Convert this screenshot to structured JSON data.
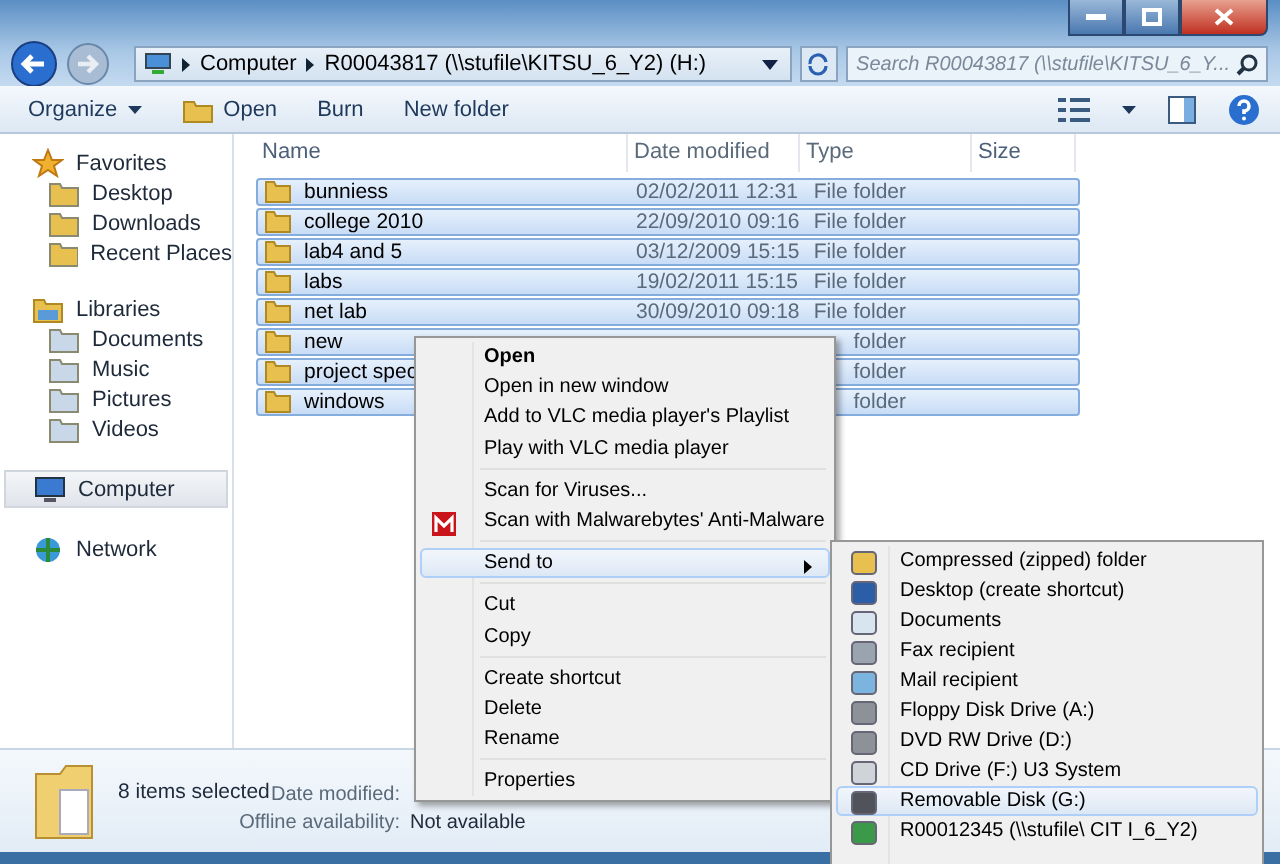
{
  "address": {
    "crumbs": [
      "Computer",
      "R00043817 (\\\\stufile\\KITSU_6_Y2) (H:)"
    ]
  },
  "search": {
    "placeholder": "Search R00043817 (\\\\stufile\\KITSU_6_Y..."
  },
  "toolbar": [
    {
      "label": "Organize",
      "kind": "menu"
    },
    {
      "label": "Open",
      "kind": "icon"
    },
    {
      "label": "Burn",
      "kind": "plain"
    },
    {
      "label": "New folder",
      "kind": "plain"
    }
  ],
  "sidebar": [
    {
      "label": "Favorites",
      "selected": false,
      "children": [
        {
          "label": "Desktop"
        },
        {
          "label": "Downloads"
        },
        {
          "label": "Recent Places"
        }
      ]
    },
    {
      "label": "Libraries",
      "selected": false,
      "children": [
        {
          "label": "Documents"
        },
        {
          "label": "Music"
        },
        {
          "label": "Pictures"
        },
        {
          "label": "Videos"
        }
      ]
    },
    {
      "label": "Computer",
      "selected": true
    },
    {
      "label": "Network",
      "selected": false
    }
  ],
  "table": {
    "columns": [
      "Name",
      "Date modified",
      "Type",
      "Size"
    ],
    "rows": [
      {
        "name": "bunniess",
        "date": "02/02/2011 12:31",
        "type": "File folder",
        "selected": true
      },
      {
        "name": "college 2010",
        "date": "22/09/2010 09:16",
        "type": "File folder",
        "selected": true
      },
      {
        "name": "lab4 and 5",
        "date": "03/12/2009 15:15",
        "type": "File folder",
        "selected": true
      },
      {
        "name": "labs",
        "date": "19/02/2011 15:15",
        "type": "File folder",
        "selected": true
      },
      {
        "name": "net lab",
        "date": "30/09/2010 09:18",
        "type": "File folder",
        "selected": true
      },
      {
        "name": "new",
        "type": "folder",
        "selected": true
      },
      {
        "name": "project spec",
        "type": "folder",
        "selected": true
      },
      {
        "name": "windows",
        "type": "folder",
        "selected": true
      }
    ]
  },
  "context_menu": [
    [
      {
        "label": "Open",
        "bold": true,
        "selected": false
      },
      {
        "label": "Open in new window",
        "bold": false,
        "selected": false
      },
      {
        "label": "Add to VLC media player's Playlist",
        "bold": false,
        "selected": false
      },
      {
        "label": "Play with VLC media player",
        "bold": false,
        "selected": false
      }
    ],
    [
      {
        "label": "Scan for Viruses...",
        "bold": false,
        "selected": false
      },
      {
        "label": "Scan with Malwarebytes' Anti-Malware",
        "bold": false,
        "selected": false,
        "icon": true
      }
    ],
    [
      {
        "label": "Send to",
        "bold": false,
        "selected": true,
        "submenu": true
      }
    ],
    [
      {
        "label": "Cut",
        "bold": false,
        "selected": false
      },
      {
        "label": "Copy",
        "bold": false,
        "selected": false
      }
    ],
    [
      {
        "label": "Create shortcut",
        "bold": false,
        "selected": false
      },
      {
        "label": "Delete",
        "bold": false,
        "selected": false
      },
      {
        "label": "Rename",
        "bold": false,
        "selected": false
      }
    ],
    [
      {
        "label": "Properties",
        "bold": false,
        "selected": false
      }
    ]
  ],
  "send_to_menu": [
    {
      "label": "Compressed (zipped) folder",
      "kind": "zip",
      "selected": false
    },
    {
      "label": "Desktop (create shortcut)",
      "kind": "desktop",
      "selected": false
    },
    {
      "label": "Documents",
      "kind": "doc",
      "selected": false
    },
    {
      "label": "Fax recipient",
      "kind": "fax",
      "selected": false
    },
    {
      "label": "Mail recipient",
      "kind": "mail",
      "selected": false
    },
    {
      "label": "Floppy Disk Drive (A:)",
      "kind": "drive",
      "selected": false
    },
    {
      "label": "DVD RW Drive (D:)",
      "kind": "drive",
      "selected": false
    },
    {
      "label": "CD Drive (F:) U3 System",
      "kind": "cd",
      "selected": false
    },
    {
      "label": "Removable Disk (G:)",
      "kind": "usb",
      "selected": true
    },
    {
      "label": "R00012345 (\\\\stufile\\ CIT I_6_Y2)",
      "kind": "net",
      "selected": false
    }
  ],
  "status_bar": {
    "count": "8 items selected",
    "date_label": "Date modified:",
    "offline_label": "Offline availability:",
    "offline_value": "Not available"
  }
}
